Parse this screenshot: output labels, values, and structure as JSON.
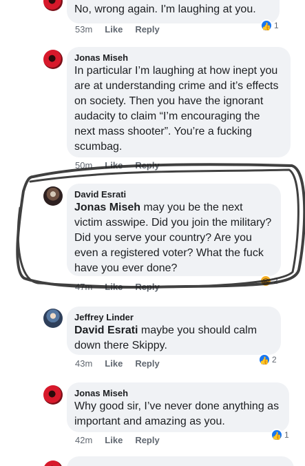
{
  "comments": [
    {
      "name": "",
      "text": "No, wrong again. I'm laughing at you.",
      "time": "53m",
      "like_label": "Like",
      "reply_label": "Reply",
      "reaction_icon": "like-icon",
      "reaction_count": "1"
    },
    {
      "name": "Jonas Miseh",
      "text": "In particular I’m laughing at how inept you are at understanding crime and it’s effects on society. Then you have the ignorant audacity to claim “I’m encouraging the next mass shooter”. You’re a fucking scumbag.",
      "time": "50m",
      "like_label": "Like",
      "reply_label": "Reply"
    },
    {
      "name": "David Esrati",
      "mention": "Jonas Miseh",
      "text": " may you be the next victim asswipe. Did you join the military? Did you serve your country? Are you even a registered voter? What the fuck have you ever done?",
      "time": "47m",
      "like_label": "Like",
      "reply_label": "Reply",
      "reaction_icon": "haha-icon",
      "reaction_count": "2"
    },
    {
      "name": "Jeffrey Linder",
      "mention": "David Esrati",
      "text": " maybe you should calm down there Skippy.",
      "time": "43m",
      "like_label": "Like",
      "reply_label": "Reply",
      "reaction_icon": "like-icon",
      "reaction_count": "2"
    },
    {
      "name": "Jonas Miseh",
      "text": "Why good sir, I’ve never done anything as important and amazing as you.",
      "time": "42m",
      "like_label": "Like",
      "reply_label": "Reply",
      "reaction_icon": "like-icon",
      "reaction_count": "1"
    }
  ],
  "colors": {
    "bubble": "#f0f2f5",
    "meta": "#606770",
    "like": "#1877f2",
    "annotation": "#1f1f1f"
  }
}
